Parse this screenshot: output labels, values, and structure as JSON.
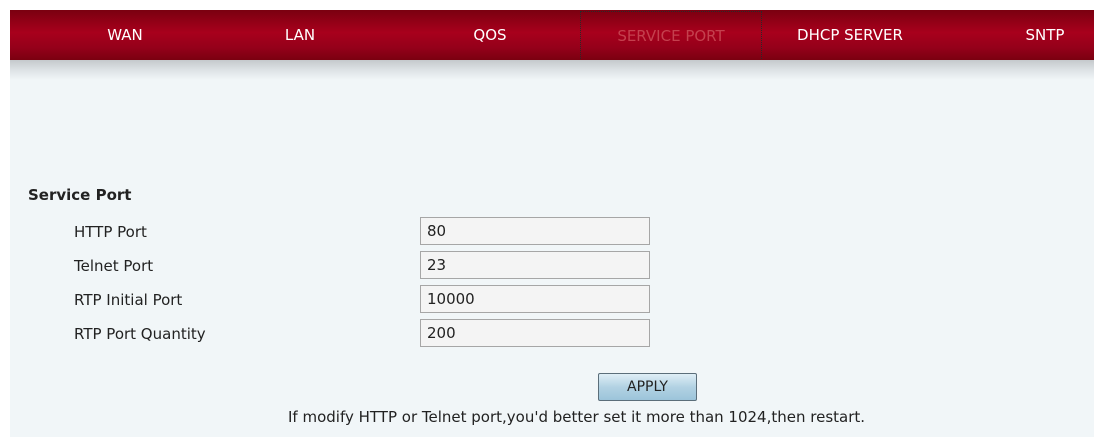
{
  "nav": {
    "tabs": [
      {
        "label": "WAN",
        "active": false
      },
      {
        "label": "LAN",
        "active": false
      },
      {
        "label": "QOS",
        "active": false
      },
      {
        "label": "SERVICE PORT",
        "active": true
      },
      {
        "label": "DHCP SERVER",
        "active": false
      },
      {
        "label": "SNTP",
        "active": false
      }
    ]
  },
  "service_port": {
    "title": "Service Port",
    "fields": [
      {
        "label": "HTTP Port",
        "value": "80"
      },
      {
        "label": "Telnet Port",
        "value": "23"
      },
      {
        "label": "RTP Initial Port",
        "value": "10000"
      },
      {
        "label": "RTP Port Quantity",
        "value": "200"
      }
    ],
    "apply_label": "APPLY",
    "note": "If modify HTTP or Telnet port,you'd better set it more than 1024,then restart."
  },
  "colors": {
    "nav_bar": "#9a0018",
    "active_tab_text": "#c4404e",
    "page_background": "#f1f6f8",
    "button": "#b2d2e3"
  }
}
